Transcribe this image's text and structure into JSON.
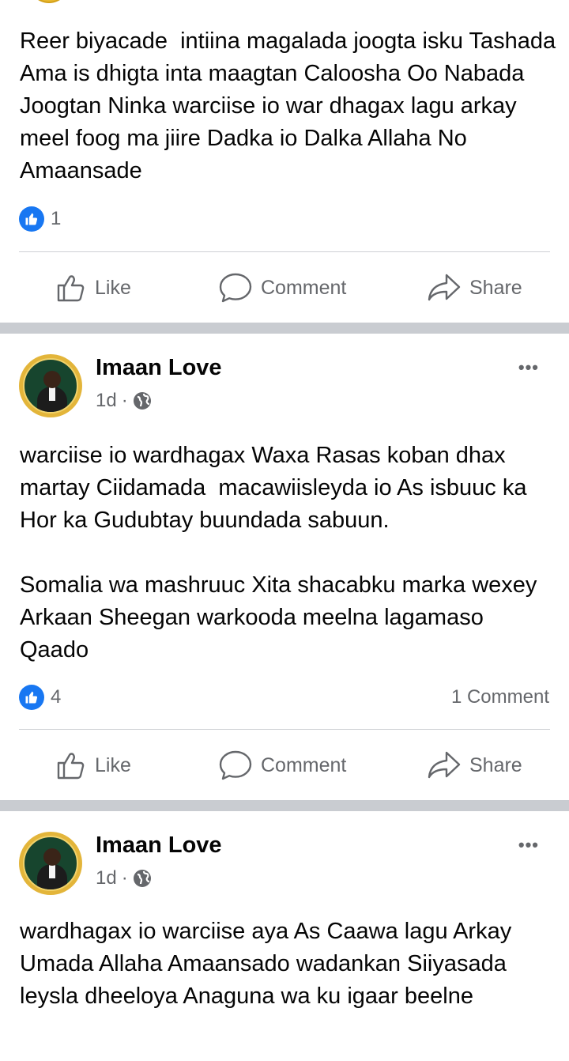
{
  "posts": [
    {
      "text": "Reer biyacade  intiina magalada joogta isku Tashada Ama is dhigta inta maagtan Caloosha Oo Nabada Joogtan Ninka warciise io war dhagax lagu arkay meel foog ma jiire Dadka io Dalka Allaha No Amaansade",
      "reaction_count": "1",
      "comment_count": ""
    },
    {
      "author": "Imaan Love",
      "time": "1d",
      "text": "warciise io wardhagax Waxa Rasas koban dhax martay Ciidamada  macawiisleyda io As isbuuc ka Hor ka Gudubtay buundada sabuun.\n\nSomalia wa mashruuc Xita shacabku marka wexey Arkaan Sheegan warkooda meelna lagamaso Qaado",
      "reaction_count": "4",
      "comment_count": "1 Comment"
    },
    {
      "author": "Imaan Love",
      "time": "1d",
      "text": "wardhagax io warciise aya As Caawa lagu Arkay Umada Allaha Amaansado wadankan Siiyasada leysla dheeloya Anaguna wa ku igaar beelne"
    }
  ],
  "actions": {
    "like": "Like",
    "comment": "Comment",
    "share": "Share"
  },
  "more_glyph": "•••",
  "meta_separator": "·",
  "colors": {
    "accent": "#1877f2",
    "secondary_text": "#65676b",
    "divider": "#c9ccd1"
  }
}
